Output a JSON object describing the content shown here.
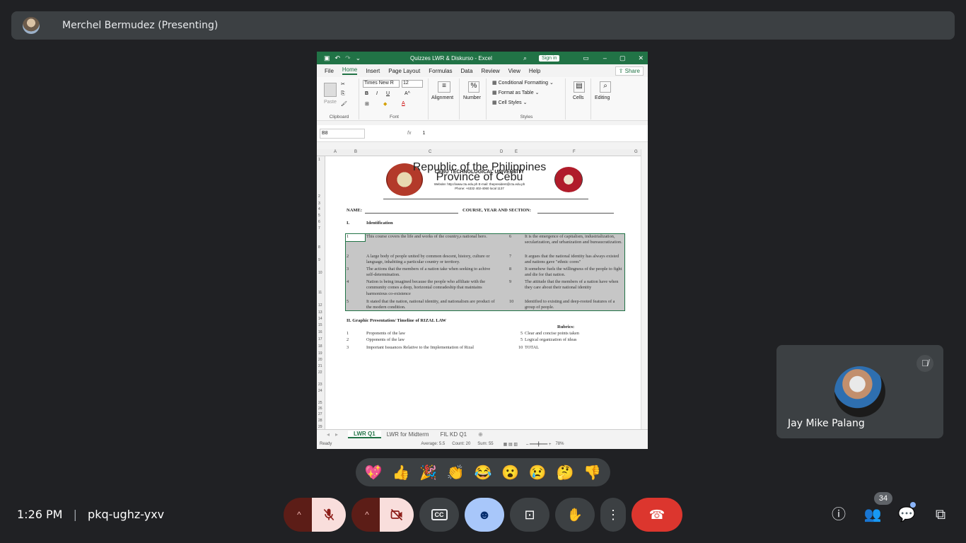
{
  "meeting": {
    "presenter_label": "Merchel Bermudez (Presenting)",
    "time": "1:26 PM",
    "code": "pkq-ughz-yxv",
    "participant_name": "Jay Mike Palang",
    "participants_count": "34",
    "reactions": [
      "💖",
      "👍",
      "🎉",
      "👏",
      "😂",
      "😮",
      "😢",
      "🤔",
      "👎"
    ]
  },
  "excel": {
    "title": "Quizzes LWR & Diskurso  -  Excel",
    "sign_in": "Sign in",
    "menu": [
      "File",
      "Home",
      "Insert",
      "Page Layout",
      "Formulas",
      "Data",
      "Review",
      "View",
      "Help"
    ],
    "share": "Share",
    "ribbon": {
      "clipboard": "Clipboard",
      "paste": "Paste",
      "font_name": "Times New R",
      "font_size": "12",
      "font": "Font",
      "alignment": "Alignment",
      "number": "Number",
      "cond_format": "Conditional Formatting",
      "format_table": "Format as Table",
      "cell_styles": "Cell Styles",
      "styles": "Styles",
      "cells": "Cells",
      "editing": "Editing"
    },
    "name_box": "B8",
    "formula_value": "1",
    "columns": [
      "A",
      "B",
      "C",
      "D",
      "E",
      "F",
      "G"
    ],
    "rows": [
      "1",
      "2",
      "3",
      "4",
      "5",
      "6",
      "7",
      "8",
      "9",
      "10",
      "11",
      "12",
      "13",
      "14",
      "15",
      "16",
      "17",
      "18",
      "19",
      "20",
      "21",
      "22",
      "23",
      "24",
      "25",
      "26",
      "27",
      "28",
      "29"
    ],
    "doc": {
      "rep": "Republic of the Philippines",
      "univ": "CEBU TECHNOLOGICAL UNIVERSITY",
      "prov": "Province of Cebu",
      "web": "Website: http://www.ctu.edu.ph    E-mail: thepresident@ctu.edu.ph",
      "phone": "Phone: +6332 402-4060 local 1137",
      "name": "NAME:",
      "course": "COURSE, YEAR AND SECTION:",
      "sec1_num": "I.",
      "sec1": "Identification",
      "items": [
        {
          "n": "1",
          "t": "This course covers the life and works of the country,s national hero.",
          "n2": "6",
          "t2": "It is the emergence of capitalism, industrialization, secularization, and urbanization and bureaucratization."
        },
        {
          "n": "2",
          "t": "A large body of people united by common descent, history, culture or language, inhabiting a particular country or territory.",
          "n2": "7",
          "t2": "It argues that the national identity has always existed and nations gave \"ethnic cores\""
        },
        {
          "n": "3",
          "t": "The actions that the members of a nation take when seeking to achive self-determination.",
          "n2": "8",
          "t2": "It somehow fuels the willingness of the people to fight and die for that nation."
        },
        {
          "n": "4",
          "t": "Nation is being imagined because the people who affiliate with the community comes a deep, horizontal comradeship that maintains harmonious co-existence",
          "n2": "9",
          "t2": "The attitude that the members of a nation have when they care about their national identity"
        },
        {
          "n": "5",
          "t": "It stated that the nation, national identity, and nationalism are product of the modern condition.",
          "n2": "10",
          "t2": "Identified to existing and deep-rooted features of a group of people."
        }
      ],
      "sec2": "II. Graphic Presentation/ Timeline of RIZAL LAW",
      "rubrics": "Rubrics:",
      "list": [
        {
          "n": "1",
          "t": "Proponents of the law",
          "p": "5",
          "r": "Clear and concise points taken"
        },
        {
          "n": "2",
          "t": "Opponents of the law",
          "p": "5",
          "r": "Logical organization of ideas"
        },
        {
          "n": "3",
          "t": "Important Issuances Relative to the Implementation of Rizal",
          "p": "10",
          "r": "TOTAL"
        }
      ]
    },
    "sheets": [
      "LWR Q1",
      "LWR for Midterm",
      "FIL KD Q1"
    ],
    "status": {
      "ready": "Ready",
      "average": "Average: 5.5",
      "count": "Count: 20",
      "sum": "Sum: 55",
      "zoom": "78%"
    }
  }
}
